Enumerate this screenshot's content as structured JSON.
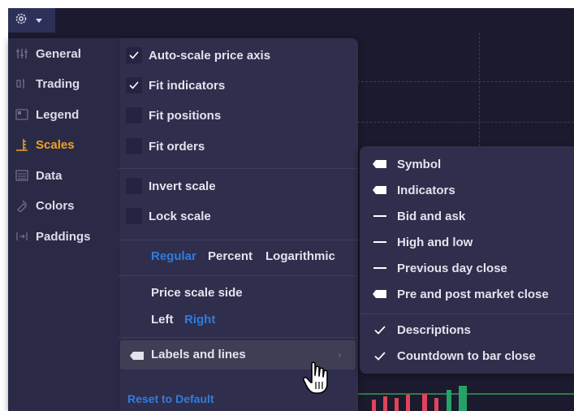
{
  "toolbar": {
    "settings_icon": "gear-icon",
    "dropdown_icon": "caret-down-icon"
  },
  "sidebar": {
    "items": [
      {
        "label": "General",
        "icon": "sliders-icon",
        "active": false
      },
      {
        "label": "Trading",
        "icon": "trading-icon",
        "active": false
      },
      {
        "label": "Legend",
        "icon": "legend-icon",
        "active": false
      },
      {
        "label": "Scales",
        "icon": "scales-icon",
        "active": true
      },
      {
        "label": "Data",
        "icon": "data-icon",
        "active": false
      },
      {
        "label": "Colors",
        "icon": "colors-icon",
        "active": false
      },
      {
        "label": "Paddings",
        "icon": "paddings-icon",
        "active": false
      }
    ]
  },
  "options": {
    "auto_scale": {
      "label": "Auto-scale price axis",
      "checked": true
    },
    "fit_indicators": {
      "label": "Fit indicators",
      "checked": true
    },
    "fit_positions": {
      "label": "Fit positions",
      "checked": false
    },
    "fit_orders": {
      "label": "Fit orders",
      "checked": false
    },
    "invert_scale": {
      "label": "Invert scale",
      "checked": false
    },
    "lock_scale": {
      "label": "Lock scale",
      "checked": false
    }
  },
  "scale_type": {
    "regular": "Regular",
    "percent": "Percent",
    "logarithmic": "Logarithmic",
    "selected": "Regular"
  },
  "price_scale_side": {
    "label": "Price scale side",
    "left": "Left",
    "right": "Right",
    "selected": "Right"
  },
  "labels_and_lines": {
    "label": "Labels and lines"
  },
  "reset": {
    "label": "Reset to Default"
  },
  "submenu": {
    "items": [
      {
        "label": "Symbol",
        "icon": "label-tag-icon"
      },
      {
        "label": "Indicators",
        "icon": "label-tag-icon"
      },
      {
        "label": "Bid and ask",
        "icon": "line-icon"
      },
      {
        "label": "High and low",
        "icon": "line-icon"
      },
      {
        "label": "Previous day close",
        "icon": "line-icon"
      },
      {
        "label": "Pre and post market close",
        "icon": "label-tag-icon"
      },
      {
        "label": "Descriptions",
        "icon": "checkmark-icon"
      },
      {
        "label": "Countdown to bar close",
        "icon": "checkmark-icon"
      }
    ]
  },
  "colors": {
    "accent": "#f0a21b",
    "link": "#2f7de2",
    "menu_bg": "#2f2e4c",
    "chart_bg": "#1b1a2e"
  }
}
